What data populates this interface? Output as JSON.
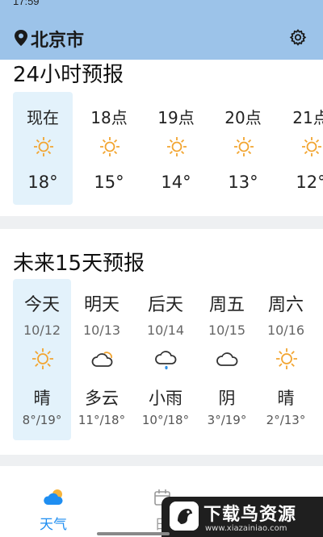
{
  "status_bar": {
    "time": "17:59"
  },
  "header": {
    "city": "北京市",
    "location_icon": "pin-icon",
    "settings_icon": "gear-icon"
  },
  "hourly": {
    "title": "24小时预报",
    "items": [
      {
        "label": "现在",
        "icon": "sun-icon",
        "temp": "18°"
      },
      {
        "label": "18点",
        "icon": "sun-icon",
        "temp": "15°"
      },
      {
        "label": "19点",
        "icon": "sun-icon",
        "temp": "14°"
      },
      {
        "label": "20点",
        "icon": "sun-icon",
        "temp": "13°"
      },
      {
        "label": "21点",
        "icon": "sun-icon",
        "temp": "12°"
      }
    ]
  },
  "daily": {
    "title": "未来15天预报",
    "items": [
      {
        "name": "今天",
        "date": "10/12",
        "icon": "sun-icon",
        "condition": "晴",
        "range": "8°/19°"
      },
      {
        "name": "明天",
        "date": "10/13",
        "icon": "partly-cloudy-icon",
        "condition": "多云",
        "range": "11°/18°"
      },
      {
        "name": "后天",
        "date": "10/14",
        "icon": "rain-icon",
        "condition": "小雨",
        "range": "10°/18°"
      },
      {
        "name": "周五",
        "date": "10/15",
        "icon": "cloud-icon",
        "condition": "阴",
        "range": "3°/19°"
      },
      {
        "name": "周六",
        "date": "10/16",
        "icon": "sun-icon",
        "condition": "晴",
        "range": "2°/13°"
      }
    ]
  },
  "tabs": [
    {
      "label": "天气",
      "icon": "weather-icon",
      "active": true
    },
    {
      "label": "日",
      "icon": "calendar-icon",
      "active": false
    }
  ],
  "watermark": {
    "title": "下载鸟资源",
    "url": "www.xiazainiao.com"
  },
  "colors": {
    "header_bg": "#9cc3e9",
    "highlight_bg": "#e3f2fb",
    "accent": "#1f8ef1",
    "sun": "#f2a531"
  }
}
